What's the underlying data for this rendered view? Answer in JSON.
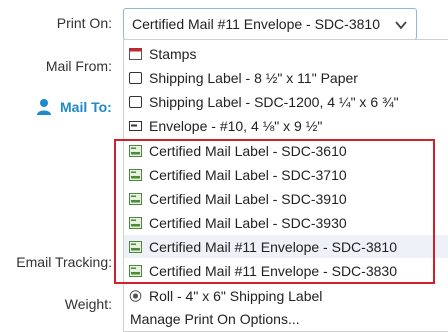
{
  "form": {
    "print_on_label": "Print On:",
    "mail_from_label": "Mail From:",
    "mail_to_label": "Mail To:",
    "email_tracking_label": "Email Tracking:",
    "weight_label": "Weight:"
  },
  "print_on_select": {
    "value": "Certified Mail #11 Envelope - SDC-3810"
  },
  "dropdown": {
    "options": [
      {
        "label": "Stamps",
        "icon": "stamp-icon"
      },
      {
        "label": "Shipping Label - 8 ½\" x 11\" Paper",
        "icon": "label-sheet-icon"
      },
      {
        "label": "Shipping Label - SDC-1200, 4 ¼\" x 6 ¾\"",
        "icon": "label-sheet-icon"
      },
      {
        "label": "Envelope - #10, 4 ⅛\" x 9 ½\"",
        "icon": "envelope-icon"
      },
      {
        "label": "Certified Mail Label - SDC-3610",
        "icon": "certified-mail-icon"
      },
      {
        "label": "Certified Mail Label - SDC-3710",
        "icon": "certified-mail-icon"
      },
      {
        "label": "Certified Mail Label - SDC-3910",
        "icon": "certified-mail-icon"
      },
      {
        "label": "Certified Mail Label - SDC-3930",
        "icon": "certified-mail-icon"
      },
      {
        "label": "Certified Mail #11 Envelope - SDC-3810",
        "icon": "certified-mail-icon",
        "selected": true
      },
      {
        "label": "Certified Mail #11 Envelope - SDC-3830",
        "icon": "certified-mail-icon"
      },
      {
        "label": "Roll - 4\" x 6\" Shipping Label",
        "icon": "roll-icon"
      }
    ],
    "manage_label": "Manage Print On Options..."
  },
  "colors": {
    "accent": "#1f8ac9",
    "highlight_box": "#d11f2c",
    "selected_row": "#eef1f8",
    "certified_icon": "#4a8a3a"
  }
}
